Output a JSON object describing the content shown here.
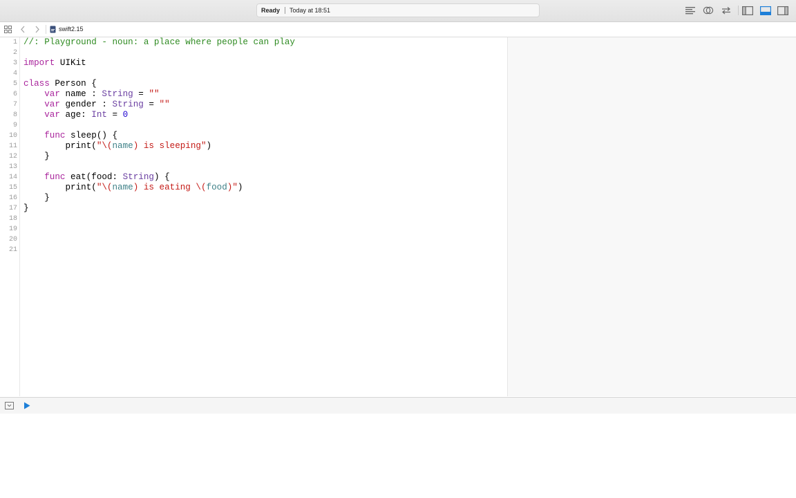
{
  "window": {
    "status": {
      "state": "Ready",
      "time": "Today at 18:51"
    },
    "toolbar_icons": [
      "standard-editor-icon",
      "assistant-editor-icon",
      "version-editor-icon",
      "navigator-toggle-icon",
      "debug-area-toggle-icon",
      "utilities-toggle-icon"
    ],
    "accent_color": "#1e7fd8"
  },
  "jumpbar": {
    "file_name": "swift2.15",
    "icons": [
      "related-items-icon",
      "back-arrow-icon",
      "forward-arrow-icon",
      "swift-file-icon"
    ]
  },
  "editor": {
    "line_numbers": [
      "1",
      "2",
      "3",
      "4",
      "5",
      "6",
      "7",
      "8",
      "9",
      "10",
      "11",
      "12",
      "13",
      "14",
      "15",
      "16",
      "17",
      "18",
      "19",
      "20",
      "21"
    ],
    "lines": [
      "//: Playground - noun: a place where people can play",
      "",
      "import UIKit",
      "",
      "class Person {",
      "    var name : String = \"\"",
      "    var gender : String = \"\"",
      "    var age: Int = 0",
      "",
      "    func sleep() {",
      "        print(\"\\(name) is sleeping\")",
      "    }",
      "",
      "    func eat(food: String) {",
      "        print(\"\\(name) is eating \\(food)\")",
      "    }",
      "}",
      "",
      "",
      "",
      ""
    ]
  },
  "debug": {
    "icons": [
      "hide-debug-area-icon",
      "run-playground-icon"
    ],
    "run_color": "#1e7fd8"
  }
}
